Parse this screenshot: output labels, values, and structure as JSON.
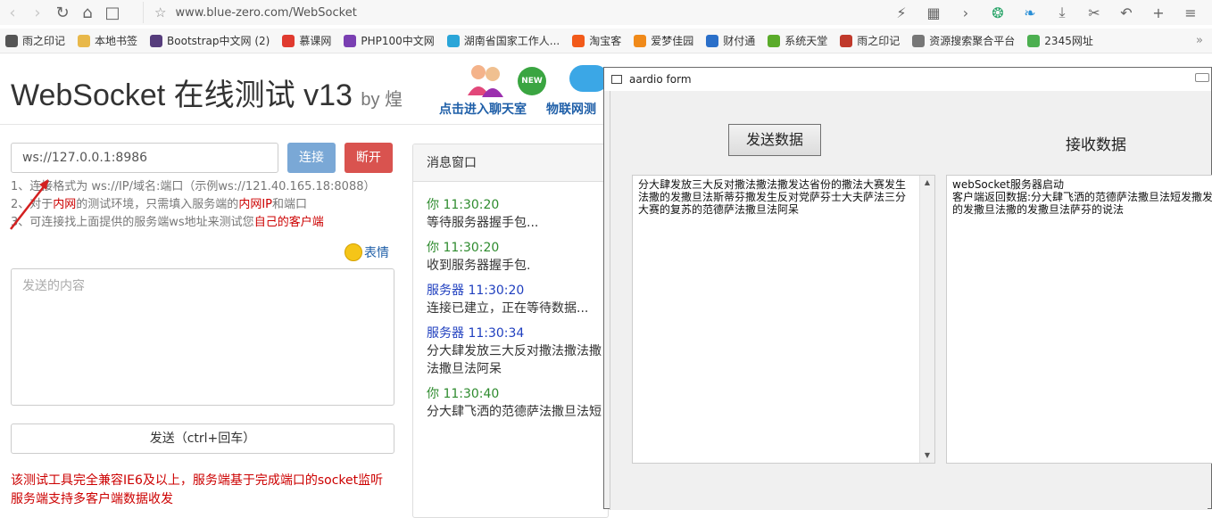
{
  "browser": {
    "url": "www.blue-zero.com/WebSocket",
    "bookmarks": [
      {
        "label": "雨之印记",
        "color": "#555555"
      },
      {
        "label": "本地书签",
        "color": "#e8b84a"
      },
      {
        "label": "Bootstrap中文网 (2)",
        "color": "#563d7c"
      },
      {
        "label": "慕课网",
        "color": "#e03a2f"
      },
      {
        "label": "PHP100中文网",
        "color": "#7a3fb2"
      },
      {
        "label": "湖南省国家工作人...",
        "color": "#2aa5d8"
      },
      {
        "label": "淘宝客",
        "color": "#f25a1a"
      },
      {
        "label": "爱梦佳园",
        "color": "#f08a1a"
      },
      {
        "label": "财付通",
        "color": "#2a6fc9"
      },
      {
        "label": "系统天堂",
        "color": "#5aab2a"
      },
      {
        "label": "雨之印记",
        "color": "#c0392b"
      },
      {
        "label": "资源搜索聚合平台",
        "color": "#777777"
      },
      {
        "label": "2345网址",
        "color": "#4caf50"
      }
    ],
    "more_bookmarks": "»"
  },
  "header": {
    "title": "WebSocket 在线测试 v13",
    "by": "by 煌",
    "chat_link": "点击进入聊天室",
    "iot_link": "物联网测",
    "new_badge": "NEW"
  },
  "connect": {
    "ws_value": "ws://127.0.0.1:8986",
    "connect_label": "连接",
    "disconnect_label": "断开"
  },
  "tips": {
    "line1": "1、连接格式为 ws://IP/域名:端口（示例ws://121.40.165.18:8088）",
    "line2_a": "2、对于",
    "line2_b": "内网",
    "line2_c": "的测试环境，只需填入服务端的",
    "line2_d": "内网IP",
    "line2_e": "和端口",
    "line3_a": "3、可连接找上面提供的服务端ws地址来测试您",
    "line3_b": "自己的客户端"
  },
  "emoji_label": "表情",
  "send": {
    "placeholder": "发送的内容",
    "button": "发送（ctrl+回车）"
  },
  "notice": {
    "line1": "该测试工具完全兼容IE6及以上，服务端基于完成端口的socket监听",
    "line2": "服务端支持多客户端数据收发"
  },
  "messages": {
    "header": "消息窗口",
    "items": [
      {
        "who": "你",
        "time": "11:30:20",
        "role": "me",
        "text": "等待服务器握手包..."
      },
      {
        "who": "你",
        "time": "11:30:20",
        "role": "me",
        "text": "收到服务器握手包."
      },
      {
        "who": "服务器",
        "time": "11:30:20",
        "role": "srv",
        "text": "连接已建立，正在等待数据..."
      },
      {
        "who": "服务器",
        "time": "11:30:34",
        "role": "srv",
        "text": "分大肆发放三大反对撒法撒法撒",
        "text2": "法撒旦法阿呆"
      },
      {
        "who": "你",
        "time": "11:30:40",
        "role": "me",
        "text": "分大肆飞洒的范德萨法撒旦法短"
      }
    ]
  },
  "form": {
    "title": "aardio form",
    "send_button": "发送数据",
    "receive_label": "接收数据",
    "left_text": "分大肆发放三大反对撒法撒法撒发达省份的撒法大赛发生法撒的发撒旦法斯蒂芬撒发生反对党萨芬士大夫萨法三分大赛的复苏的范德萨法撒旦法阿呆",
    "right_line1": "webSocket服务器启动",
    "right_line2": "客户端返回数据:分大肆飞洒的范德萨法撒旦法短发撒发",
    "right_line3": "的发撒旦法撒的发撒旦法萨芬的说法"
  }
}
